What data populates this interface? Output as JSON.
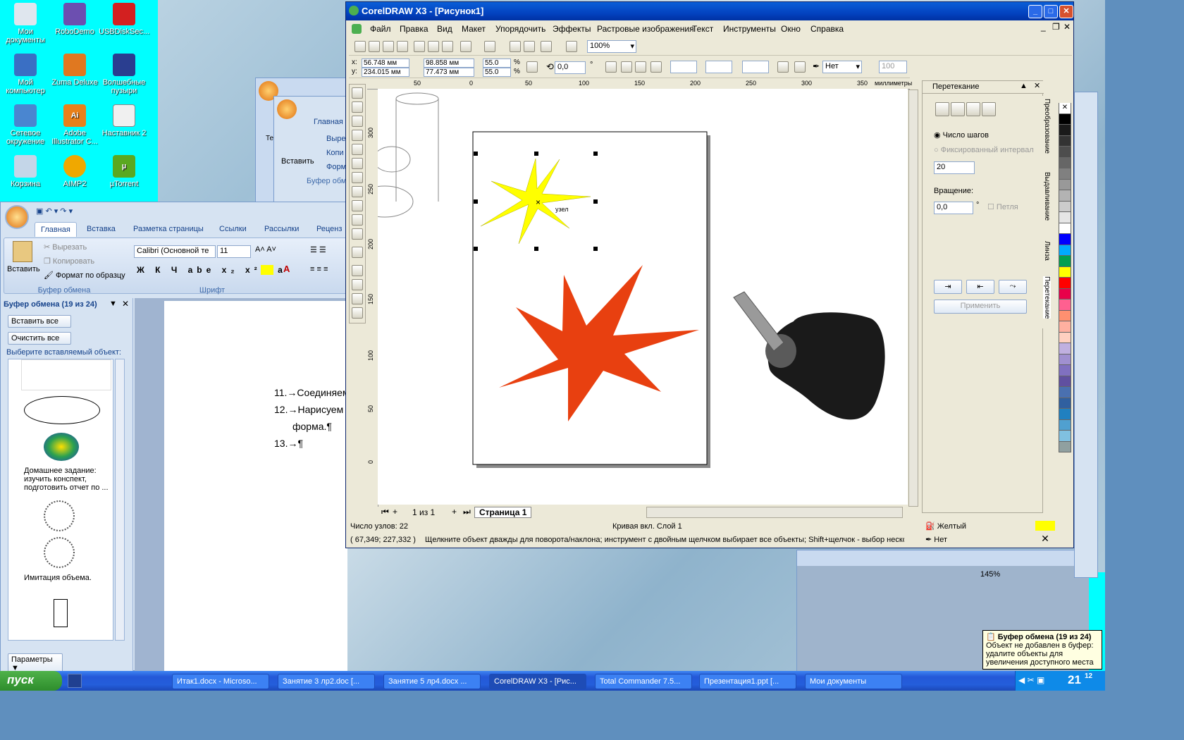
{
  "desktop": {
    "icons": [
      {
        "label": "Мои документы",
        "icon": "my-documents-icon"
      },
      {
        "label": "RoboDemo",
        "icon": "robodemo-icon"
      },
      {
        "label": "USBDiskSec...",
        "icon": "usb-icon"
      },
      {
        "label": "Мой компьютер",
        "icon": "my-computer-icon"
      },
      {
        "label": "Zuma Deluxe",
        "icon": "zuma-icon"
      },
      {
        "label": "Волшебные пузыри",
        "icon": "bubbles-icon"
      },
      {
        "label": "Сетевое окружение",
        "icon": "network-icon"
      },
      {
        "label": "Adobe Illustrator C...",
        "icon": "illustrator-icon"
      },
      {
        "label": "Наставник 2",
        "icon": "nastavnik-icon"
      },
      {
        "label": "Корзина",
        "icon": "recycle-bin-icon"
      },
      {
        "label": "AIMP2",
        "icon": "aimp-icon"
      },
      {
        "label": "µTorrent",
        "icon": "utorrent-icon"
      }
    ]
  },
  "word_bg": {
    "tab_home": "Главная",
    "paste": "Вставить",
    "cut": "Выре",
    "copy": "Копи",
    "format": "Форм",
    "group_clipboard": "Буфер обм",
    "te": "Те"
  },
  "word": {
    "tabs": [
      "Главная",
      "Вставка",
      "Разметка страницы",
      "Ссылки",
      "Рассылки",
      "Реценз"
    ],
    "paste": "Вставить",
    "cut": "Вырезать",
    "copy": "Копировать",
    "format_painter": "Формат по образцу",
    "group_clipboard": "Буфер обмена",
    "group_font": "Шрифт",
    "font_name": "Calibri (Основной те",
    "font_size": "11",
    "pane_title": "Буфер обмена (19 из 24)",
    "paste_all": "Вставить все",
    "clear_all": "Очистить все",
    "choose": "Выберите вставляемый объект:",
    "item_text_1": "Домашнее задание: изучить конспект, подготовить отчет по ...",
    "item_text_2": "Имитация объема.",
    "options": "Параметры",
    "doc_lines": [
      "11.→Соединяем",
      "12.→Нарисуем",
      "форма.¶",
      "13.→¶"
    ],
    "zoom": "145%"
  },
  "corel": {
    "title": "CorelDRAW X3 - [Рисунок1]",
    "menu": [
      "Файл",
      "Правка",
      "Вид",
      "Макет",
      "Упорядочить",
      "Эффекты",
      "Растровые изображения",
      "Текст",
      "Инструменты",
      "Окно",
      "Справка"
    ],
    "zoom": "100%",
    "x": "56.748 мм",
    "y": "234.015 мм",
    "w": "98.858 мм",
    "h": "77.473 мм",
    "sx": "55.0",
    "sy": "55.0",
    "pct": "%",
    "rotation": "0,0",
    "deg": "°",
    "outline": "Нет",
    "outline_pct": "100",
    "ruler_marks": [
      "50",
      "0",
      "50",
      "100",
      "150",
      "200",
      "250",
      "300",
      "350"
    ],
    "ruler_unit": "миллиметры",
    "vruler_marks": [
      "300",
      "250",
      "200",
      "150",
      "100",
      "50",
      "0"
    ],
    "page_nav": "1 из 1",
    "page_tab": "Страница 1",
    "node_label": "узел",
    "status_nodes": "Число узлов: 22",
    "status_object": "Кривая вкл. Слой 1",
    "status_coords": "( 67,349; 227,332 )",
    "status_hint": "Щелкните объект дважды для поворота/наклона; инструмент с двойным щелчком выбирает все объекты; Shift+щелчок - выбор нескол...",
    "fill_name": "Желтый",
    "fill_color": "#ffff00",
    "outline_name": "Нет",
    "docker": {
      "title": "Перетекание",
      "steps_radio": "Число шагов",
      "fixed_radio": "Фиксированный интервал",
      "steps": "20",
      "rotation_label": "Вращение:",
      "rotation": "0,0",
      "deg": "°",
      "loop": "Петля",
      "apply": "Применить"
    },
    "docker_tabs": [
      "Преобразование",
      "Выдавливание",
      "Линза",
      "Перетекание"
    ]
  },
  "taskbar": {
    "start": "пуск",
    "tasks": [
      "Итак1.docx - Microso...",
      "Занятие 3 лр2.doc [...",
      "Занятие 5 лр4.docx ...",
      "CorelDRAW X3 - [Рис...",
      "Total Commander 7.5...",
      "Презентация1.ppt [...",
      "Мои документы"
    ],
    "time": "21",
    "time_min": "12"
  },
  "tooltip": {
    "title": "Буфер обмена (19 из 24)",
    "text": "Объект не добавлен в буфер: удалите объекты для увеличения доступного места"
  },
  "colors": {
    "star_yellow": "#ffff00",
    "star_orange": "#e84010",
    "accent": "#0a5fd8"
  }
}
